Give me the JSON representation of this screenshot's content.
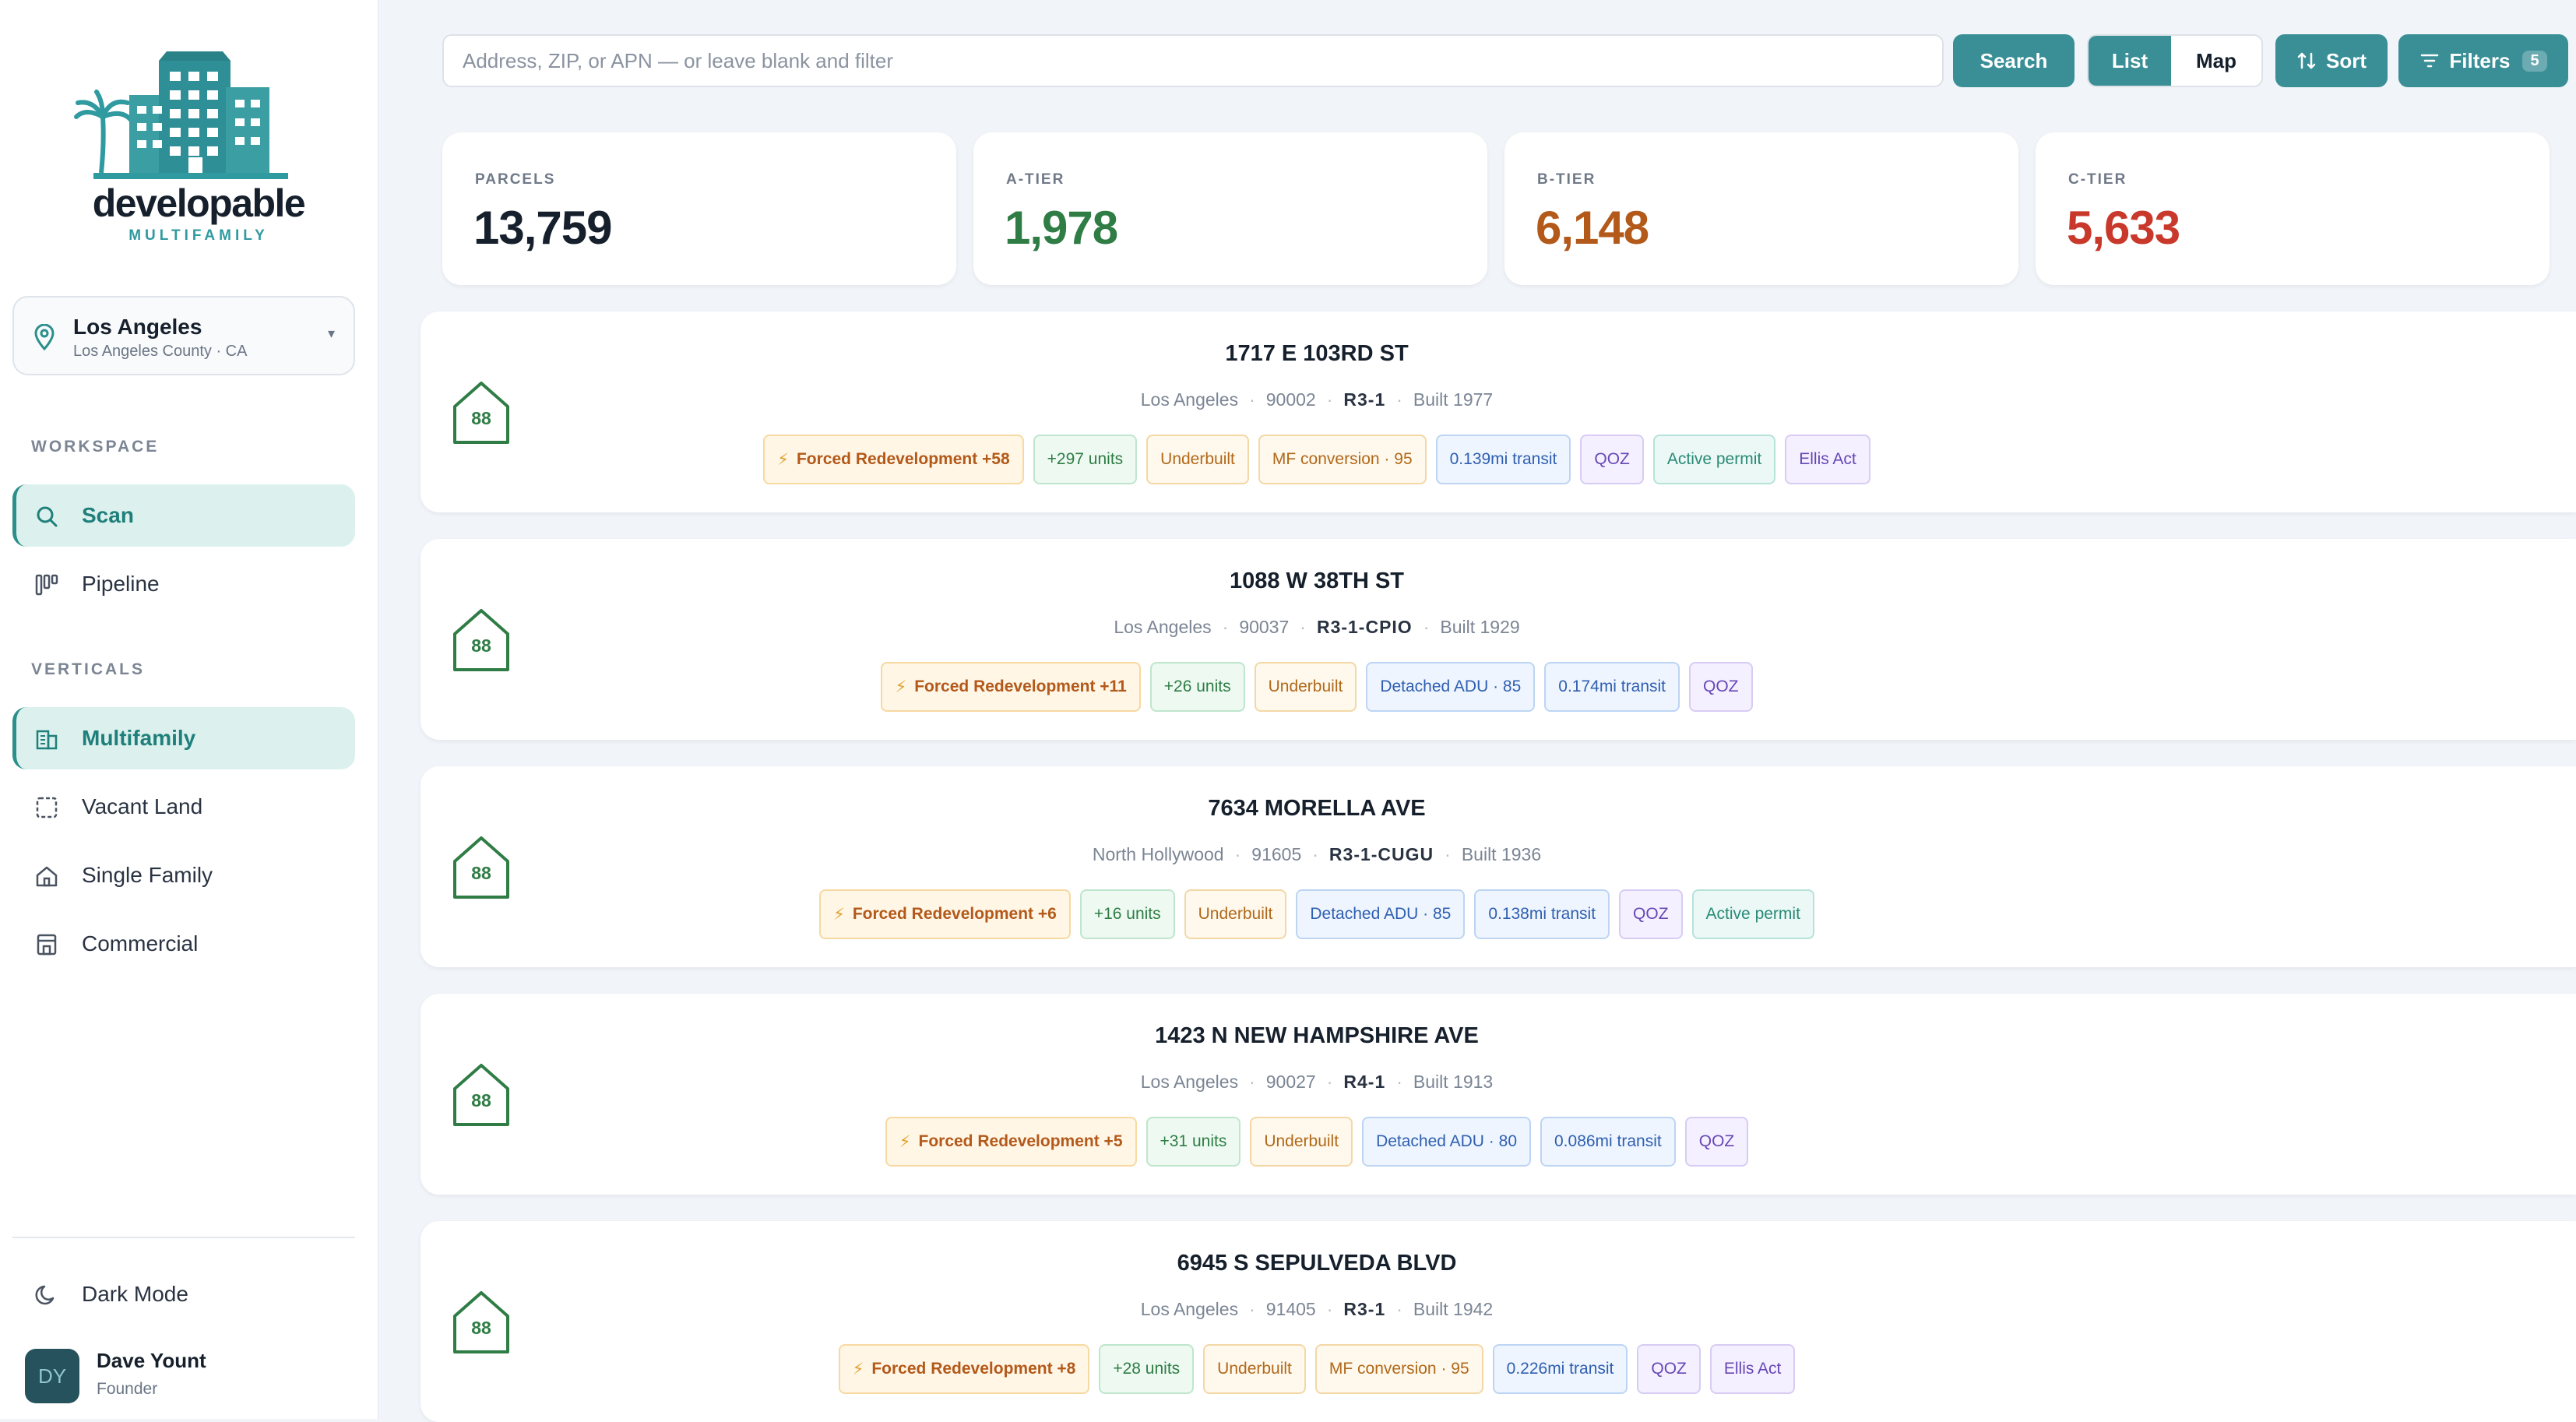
{
  "brand": {
    "name": "developable",
    "subtitle": "MULTIFAMILY"
  },
  "location": {
    "city": "Los Angeles",
    "county": "Los Angeles County · CA",
    "caret": "▾"
  },
  "sidebar": {
    "workspace_label": "WORKSPACE",
    "workspace_items": [
      {
        "label": "Scan",
        "icon": "search-icon",
        "active": true
      },
      {
        "label": "Pipeline",
        "icon": "kanban-icon",
        "active": false
      }
    ],
    "verticals_label": "VERTICALS",
    "vertical_items": [
      {
        "label": "Multifamily",
        "icon": "building-icon",
        "active": true
      },
      {
        "label": "Vacant Land",
        "icon": "dashed-square-icon",
        "active": false
      },
      {
        "label": "Single Family",
        "icon": "house-icon",
        "active": false
      },
      {
        "label": "Commercial",
        "icon": "store-icon",
        "active": false
      }
    ],
    "dark_mode_label": "Dark Mode",
    "user": {
      "initials": "DY",
      "name": "Dave Yount",
      "role": "Founder"
    }
  },
  "toolbar": {
    "search_placeholder": "Address, ZIP, or APN — or leave blank and filter",
    "search_value": "",
    "search_button": "Search",
    "view_list": "List",
    "view_map": "Map",
    "sort_label": "Sort",
    "filters_label": "Filters",
    "filters_count": "5"
  },
  "stats": [
    {
      "label": "PARCELS",
      "value": "13,759",
      "color": "#16202c"
    },
    {
      "label": "A-TIER",
      "value": "1,978",
      "color": "#2f7d45"
    },
    {
      "label": "B-TIER",
      "value": "6,148",
      "color": "#b3591a"
    },
    {
      "label": "C-TIER",
      "value": "5,633",
      "color": "#c8382b"
    }
  ],
  "parcels": [
    {
      "score": "88",
      "address": "1717 E 103RD ST",
      "city": "Los Angeles",
      "zip": "90002",
      "zone": "R3-1",
      "built": "Built 1977",
      "tags": [
        {
          "text": "Forced Redevelopment +58",
          "style": "orange"
        },
        {
          "text": "+297 units",
          "style": "green"
        },
        {
          "text": "Underbuilt",
          "style": "amber"
        },
        {
          "text": "MF conversion · 95",
          "style": "amber"
        },
        {
          "text": "0.139mi transit",
          "style": "blue"
        },
        {
          "text": "QOZ",
          "style": "purple"
        },
        {
          "text": "Active permit",
          "style": "teal"
        },
        {
          "text": "Ellis Act",
          "style": "purple"
        }
      ]
    },
    {
      "score": "88",
      "address": "1088 W 38TH ST",
      "city": "Los Angeles",
      "zip": "90037",
      "zone": "R3-1-CPIO",
      "built": "Built 1929",
      "tags": [
        {
          "text": "Forced Redevelopment +11",
          "style": "orange"
        },
        {
          "text": "+26 units",
          "style": "green"
        },
        {
          "text": "Underbuilt",
          "style": "amber"
        },
        {
          "text": "Detached ADU · 85",
          "style": "blue"
        },
        {
          "text": "0.174mi transit",
          "style": "blue"
        },
        {
          "text": "QOZ",
          "style": "purple"
        }
      ]
    },
    {
      "score": "88",
      "address": "7634 MORELLA AVE",
      "city": "North Hollywood",
      "zip": "91605",
      "zone": "R3-1-CUGU",
      "built": "Built 1936",
      "tags": [
        {
          "text": "Forced Redevelopment +6",
          "style": "orange"
        },
        {
          "text": "+16 units",
          "style": "green"
        },
        {
          "text": "Underbuilt",
          "style": "amber"
        },
        {
          "text": "Detached ADU · 85",
          "style": "blue"
        },
        {
          "text": "0.138mi transit",
          "style": "blue"
        },
        {
          "text": "QOZ",
          "style": "purple"
        },
        {
          "text": "Active permit",
          "style": "teal"
        }
      ]
    },
    {
      "score": "88",
      "address": "1423 N NEW HAMPSHIRE AVE",
      "city": "Los Angeles",
      "zip": "90027",
      "zone": "R4-1",
      "built": "Built 1913",
      "tags": [
        {
          "text": "Forced Redevelopment +5",
          "style": "orange"
        },
        {
          "text": "+31 units",
          "style": "green"
        },
        {
          "text": "Underbuilt",
          "style": "amber"
        },
        {
          "text": "Detached ADU · 80",
          "style": "blue"
        },
        {
          "text": "0.086mi transit",
          "style": "blue"
        },
        {
          "text": "QOZ",
          "style": "purple"
        }
      ]
    },
    {
      "score": "88",
      "address": "6945 S SEPULVEDA BLVD",
      "city": "Los Angeles",
      "zip": "91405",
      "zone": "R3-1",
      "built": "Built 1942",
      "tags": [
        {
          "text": "Forced Redevelopment +8",
          "style": "orange"
        },
        {
          "text": "+28 units",
          "style": "green"
        },
        {
          "text": "Underbuilt",
          "style": "amber"
        },
        {
          "text": "MF conversion · 95",
          "style": "amber"
        },
        {
          "text": "0.226mi transit",
          "style": "blue"
        },
        {
          "text": "QOZ",
          "style": "purple"
        },
        {
          "text": "Ellis Act",
          "style": "purple"
        }
      ]
    }
  ]
}
